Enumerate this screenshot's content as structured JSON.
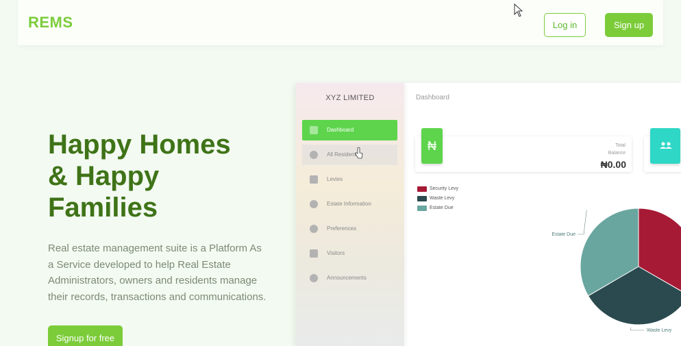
{
  "header": {
    "logo": "REMS",
    "login_label": "Log in",
    "signup_label": "Sign up"
  },
  "hero": {
    "title_lines": [
      "Happy Homes",
      "& Happy",
      "Families"
    ],
    "description": "Real estate management suite is a Platform As a Service developed to help Real Estate Administrators, owners and residents manage their records, transactions and communications.",
    "cta_label": "Signup for free"
  },
  "mockup": {
    "company": "XYZ LIMITED",
    "breadcrumb": "Dashboard",
    "nav": [
      {
        "label": "Dashboard",
        "icon": "dashboard-icon",
        "active": true
      },
      {
        "label": "All Residents",
        "icon": "user-icon",
        "active": false
      },
      {
        "label": "Levies",
        "icon": "card-icon",
        "active": false
      },
      {
        "label": "Estate Information",
        "icon": "info-icon",
        "active": false
      },
      {
        "label": "Preferences",
        "icon": "gear-icon",
        "active": false
      },
      {
        "label": "Visitors",
        "icon": "people-icon",
        "active": false
      },
      {
        "label": "Announcements",
        "icon": "bell-icon",
        "active": false
      }
    ],
    "balance_card": {
      "icon_symbol": "₦",
      "label_line1": "Total",
      "label_line2": "Balance",
      "value": "₦0.00"
    },
    "colors": {
      "accent": "#7ccc3a",
      "active_nav": "#5dd44c",
      "teal_card": "#2fd7c6"
    }
  },
  "chart_data": {
    "type": "pie",
    "series": [
      {
        "name": "Security Levy",
        "value": 33.3,
        "color": "#a61a35"
      },
      {
        "name": "Waste Levy",
        "value": 33.3,
        "color": "#2a4a4f"
      },
      {
        "name": "Estate Due",
        "value": 33.4,
        "color": "#6aa6a0"
      }
    ],
    "legend": [
      "Security Levy",
      "Waste Levy",
      "Estate Due"
    ],
    "legend_position": "top-left",
    "slice_labels": [
      "Estate Due",
      "Waste Levy"
    ]
  }
}
